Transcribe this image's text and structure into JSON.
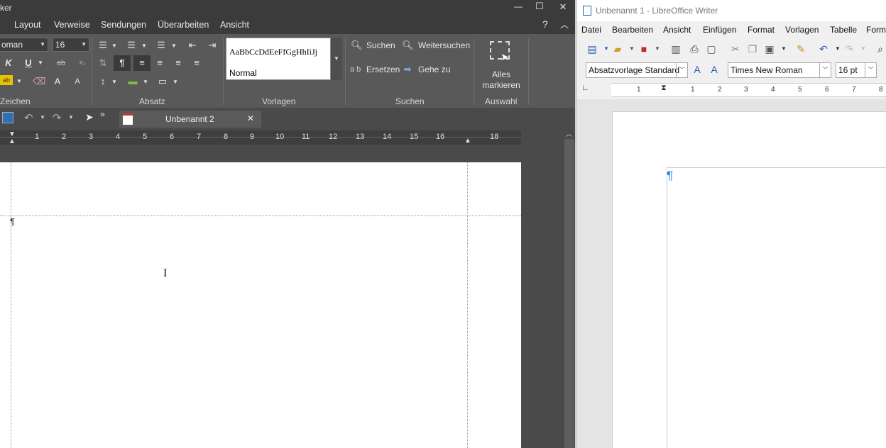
{
  "left_app": {
    "title": "ker",
    "window_controls": {
      "minimize": "—",
      "maximize": "☐",
      "close": "✕"
    },
    "menu": [
      "Layout",
      "Verweise",
      "Sendungen",
      "Überarbeiten",
      "Ansicht"
    ],
    "help": "?",
    "collapse": "︿",
    "ribbon": {
      "font_name": "oman",
      "font_size": "16",
      "bold": "K",
      "underline": "U",
      "strike": "ab",
      "group_labels": [
        "Zeichen",
        "Absatz",
        "Vorlagen",
        "Suchen",
        "Auswahl"
      ],
      "style_preview": "AaBbCcDdEeFfGgHhIiJj",
      "style_name": "Normal",
      "find": "Suchen",
      "find_next": "Weitersuchen",
      "replace_prefix": "a b",
      "replace": "Ersetzen",
      "goto": "Gehe zu",
      "select_all_line1": "Alles",
      "select_all_line2": "markieren"
    },
    "doc_tab": "Unbenannt 2",
    "ruler_numbers": [
      "1",
      "2",
      "3",
      "4",
      "5",
      "6",
      "7",
      "8",
      "9",
      "10",
      "11",
      "12",
      "13",
      "14",
      "15",
      "16",
      "18"
    ]
  },
  "right_app": {
    "title": "Unbenannt 1 - LibreOffice Writer",
    "menu": [
      "Datei",
      "Bearbeiten",
      "Ansicht",
      "Einfügen",
      "Format",
      "Vorlagen",
      "Tabelle",
      "Form"
    ],
    "para_style": "Absatzvorlage Standard",
    "font_name": "Times New Roman",
    "font_size": "16 pt",
    "ruler_numbers": [
      "1",
      "1",
      "2",
      "3",
      "4",
      "5",
      "6",
      "7",
      "8"
    ],
    "pilcrow": "¶"
  },
  "colors": {
    "dark_bg": "#4a4a4a",
    "ribbon": "#595959",
    "accent_blue": "#2a5fb0"
  }
}
